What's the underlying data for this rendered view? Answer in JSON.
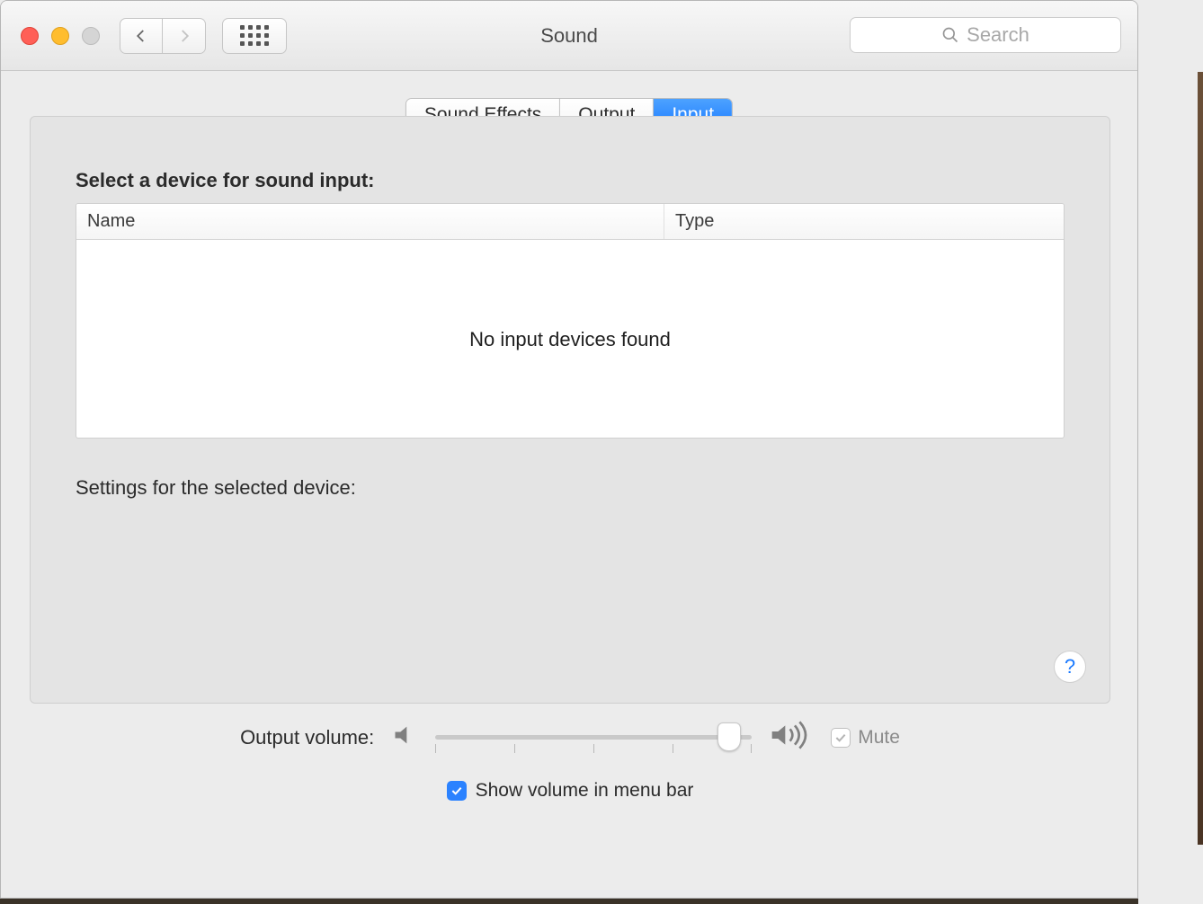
{
  "window": {
    "title": "Sound"
  },
  "search": {
    "placeholder": "Search"
  },
  "tabs": {
    "sound_effects": "Sound Effects",
    "output": "Output",
    "input": "Input"
  },
  "panel": {
    "select_label": "Select a device for sound input:",
    "col_name": "Name",
    "col_type": "Type",
    "empty": "No input devices found",
    "settings_label": "Settings for the selected device:"
  },
  "footer": {
    "volume_label": "Output volume:",
    "mute_label": "Mute",
    "show_label": "Show volume in menu bar"
  },
  "help": "?"
}
